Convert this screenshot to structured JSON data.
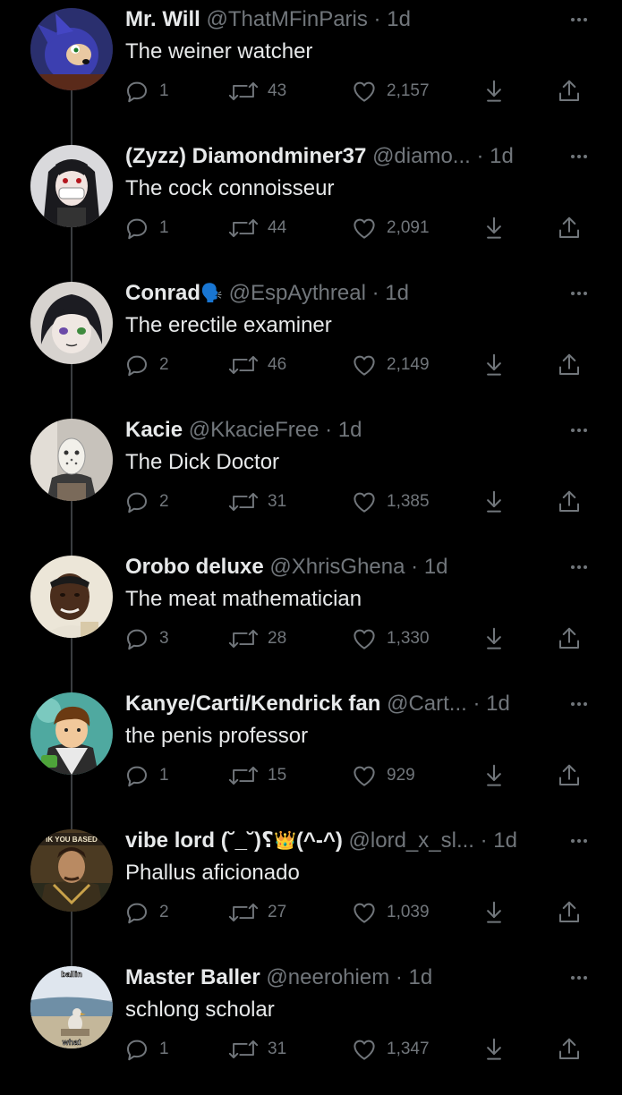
{
  "tweets": [
    {
      "name": "Mr. Will",
      "emoji": "",
      "handle": "@ThatMFinParis",
      "dot": "·",
      "time": "1d",
      "text": "The weiner watcher",
      "replies": "1",
      "retweets": "43",
      "likes": "2,157",
      "avatar_icon": "avatar-blue-hedgehog"
    },
    {
      "name": "(Zyzz) Diamondminer37",
      "emoji": "",
      "handle": "@diamo...",
      "dot": "·",
      "time": "1d",
      "text": "The cock connoisseur",
      "replies": "1",
      "retweets": "44",
      "likes": "2,091",
      "avatar_icon": "avatar-anime-masked"
    },
    {
      "name": "Conrad",
      "emoji": "🗣️",
      "handle": "@EspAythreal",
      "dot": "·",
      "time": "1d",
      "text": "The erectile examiner",
      "replies": "2",
      "retweets": "46",
      "likes": "2,149",
      "avatar_icon": "avatar-anime-dark-hair"
    },
    {
      "name": "Kacie",
      "emoji": "",
      "handle": "@KkacieFree",
      "dot": "·",
      "time": "1d",
      "text": "The Dick Doctor",
      "replies": "2",
      "retweets": "31",
      "likes": "1,385",
      "avatar_icon": "avatar-hockey-mask"
    },
    {
      "name": "Orobo deluxe",
      "emoji": "",
      "handle": "@XhrisGhena",
      "dot": "·",
      "time": "1d",
      "text": "The meat mathematician",
      "replies": "3",
      "retweets": "28",
      "likes": "1,330",
      "avatar_icon": "avatar-person-smiling"
    },
    {
      "name": "Kanye/Carti/Kendrick fan",
      "emoji": "",
      "handle": "@Cart...",
      "dot": "·",
      "time": "1d",
      "text": "the penis professor",
      "replies": "1",
      "retweets": "15",
      "likes": "929",
      "avatar_icon": "avatar-cartoon-boy"
    },
    {
      "name": "vibe lord (˘_˘)؟",
      "emoji": "👑",
      "name_suffix": "(^-^)",
      "handle": "@lord_x_sl...",
      "dot": "·",
      "time": "1d",
      "text": "Phallus aficionado",
      "replies": "2",
      "retweets": "27",
      "likes": "1,039",
      "avatar_icon": "avatar-painted-portrait"
    },
    {
      "name": "Master Baller",
      "emoji": "",
      "handle": "@neerohiem",
      "dot": "·",
      "time": "1d",
      "text": "schlong scholar",
      "replies": "1",
      "retweets": "31",
      "likes": "1,347",
      "avatar_icon": "avatar-beach-bird"
    }
  ],
  "avatar_captions": {
    "t6": "IK YOU BASED",
    "t7_top": "ballin",
    "t7_bottom": "what"
  },
  "colors": {
    "background": "#000000",
    "text_primary": "#e7e9ea",
    "text_secondary": "#71767b",
    "thread_line": "#3a3d40"
  }
}
